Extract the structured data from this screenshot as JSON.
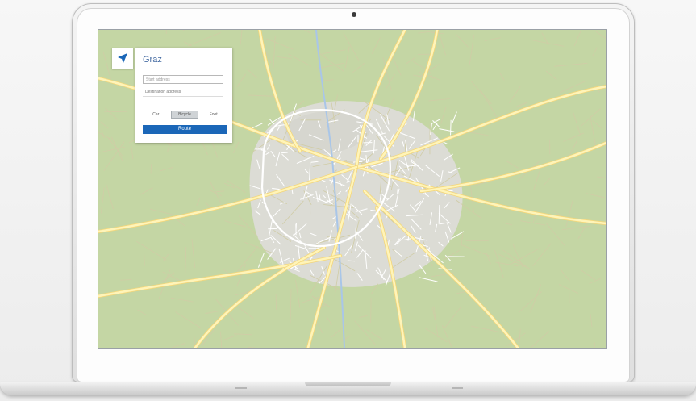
{
  "device": {
    "type": "laptop"
  },
  "map": {
    "colors": {
      "land": "#c4d6a4",
      "urban": "#dcdcd5",
      "road": "#fff4b8",
      "road_outline": "#f4d77a",
      "river": "#a9c6e8",
      "grid": "#d0cca6"
    }
  },
  "panel": {
    "icon": "navigation-arrow-icon",
    "title": "Graz",
    "start_placeholder": "Start address",
    "destination_value": "Destination address",
    "modes": [
      {
        "label": "Car",
        "active": false
      },
      {
        "label": "Bicycle",
        "active": true
      },
      {
        "label": "Foot",
        "active": false
      }
    ],
    "route_label": "Route",
    "accent": "#1b67b8"
  }
}
